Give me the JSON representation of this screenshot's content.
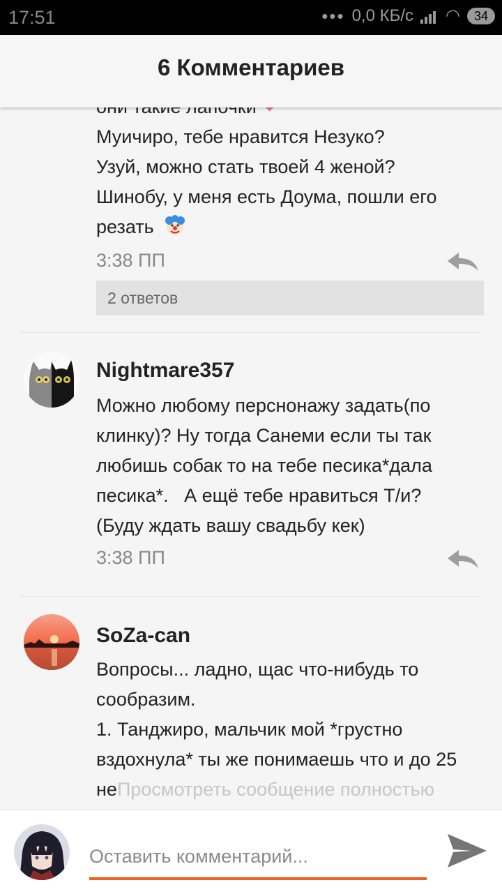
{
  "status": {
    "time": "17:51",
    "network": "0,0 КБ/с",
    "battery": "34"
  },
  "header": {
    "title": "6 Комментариев"
  },
  "comment1": {
    "lines": [
      "они такие лапочки",
      "Муичиро, тебе нравится Незуко?",
      "Узуй, можно стать твоей 4 женой?",
      "Шинобу, у меня есть Доума, пошли его",
      "резать"
    ],
    "time": "3:38 ПП",
    "replies": "2 ответов"
  },
  "comment2": {
    "author": "Nightmare357",
    "lines": [
      "Можно любому перснонажу задать(по",
      "клинку)? Ну тогда Санеми если ты так",
      "любишь собак то на тебе песика*дала",
      "песика*.   А ещё тебе нравиться Т/и?",
      "(Буду ждать вашу свадьбу кек)"
    ],
    "time": "3:38 ПП"
  },
  "comment3": {
    "author": "SoZa-can",
    "lines": [
      "Вопросы... ладно, щас что-нибудь то",
      "сообразим.",
      "1. Танджиро, мальчик мой *грустно",
      "вздохнула* ты же понимаешь что и до 25",
      "не"
    ],
    "more": "Просмотреть сообщение полностью"
  },
  "composer": {
    "placeholder": "Оставить комментарий..."
  },
  "colors": {
    "accent": "#f06121",
    "text": "#222222",
    "muted": "#888888"
  },
  "icons": [
    "reply-icon",
    "send-icon",
    "heart-emoji",
    "clown-emoji",
    "wifi-icon",
    "signal-icon",
    "battery-icon"
  ]
}
